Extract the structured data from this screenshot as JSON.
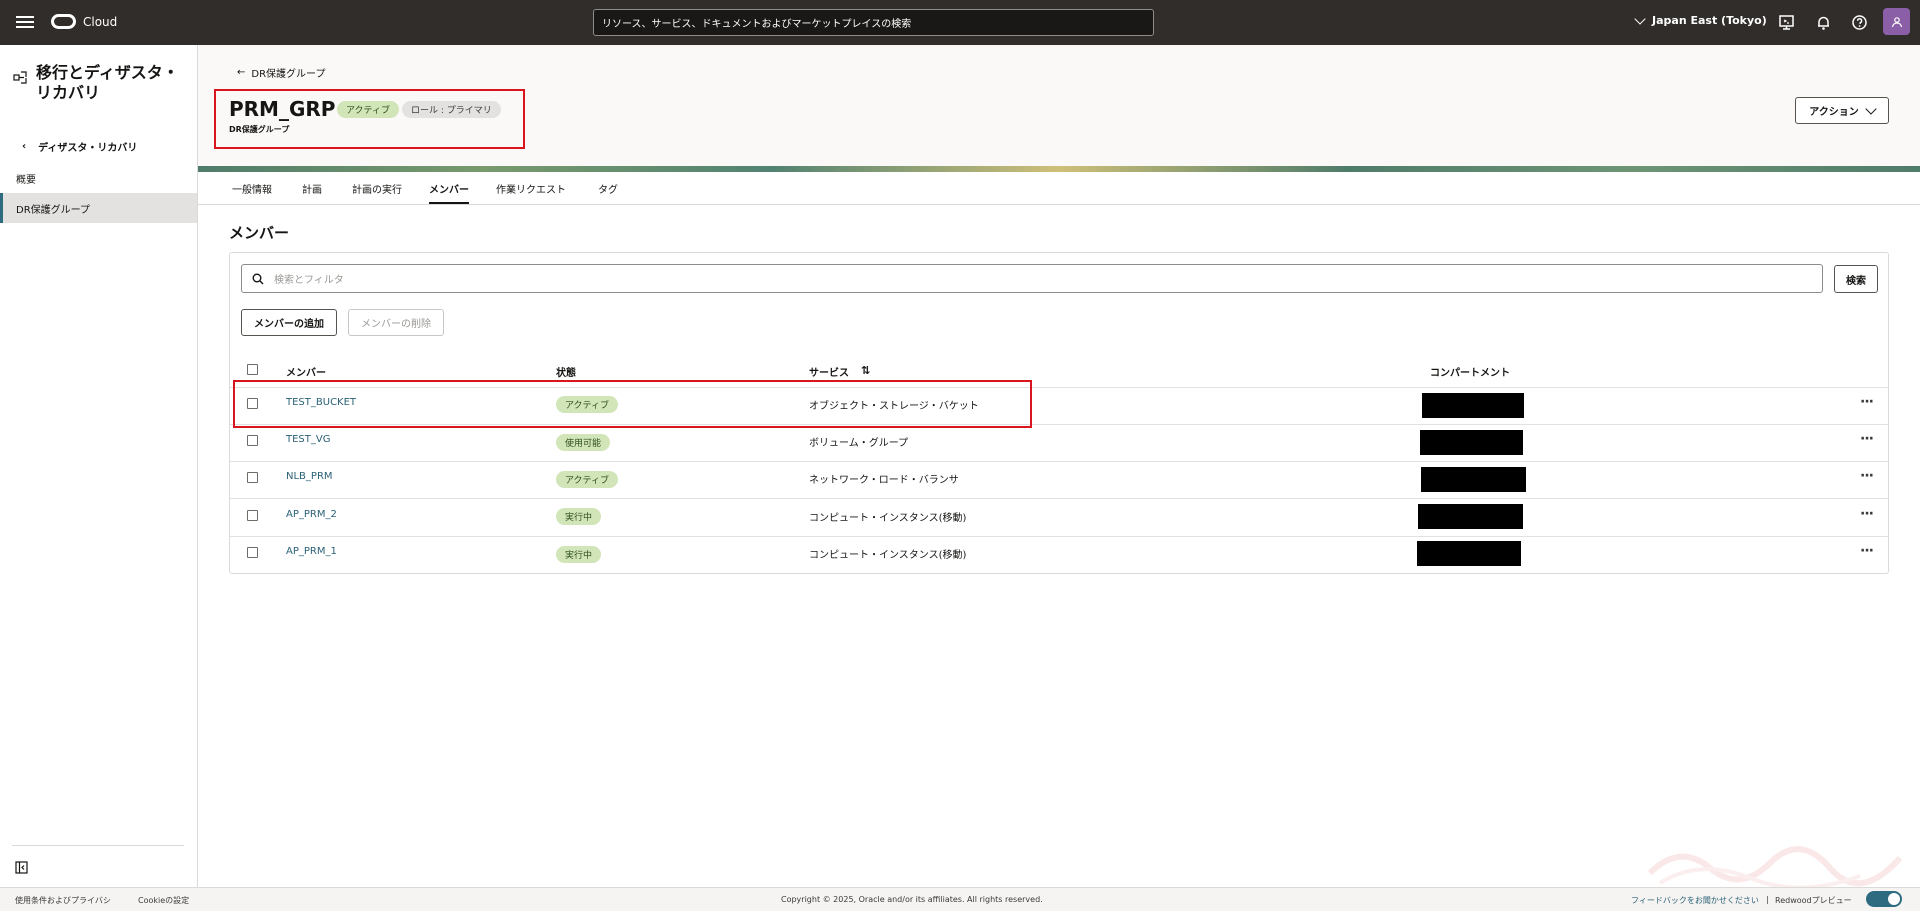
{
  "topbar": {
    "brand": "Cloud",
    "search_placeholder": "リソース、サービス、ドキュメントおよびマーケットプレイスの検索",
    "region": "Japan East (Tokyo)"
  },
  "sidebar": {
    "title": "移行とディザスタ・リカバリ",
    "back_label": "ディザスタ・リカバリ",
    "items": [
      {
        "label": "概要"
      },
      {
        "label": "DR保護グループ"
      }
    ]
  },
  "header": {
    "back_label": "DR保護グループ",
    "title": "PRM_GRP",
    "badge_status": "アクティブ",
    "badge_role": "ロール : プライマリ",
    "subtitle": "DR保護グループ",
    "action_label": "アクション"
  },
  "tabs": [
    {
      "label": "一般情報"
    },
    {
      "label": "計画"
    },
    {
      "label": "計画の実行"
    },
    {
      "label": "メンバー"
    },
    {
      "label": "作業リクエスト"
    },
    {
      "label": "タグ"
    }
  ],
  "members": {
    "section_title": "メンバー",
    "filter_placeholder": "検索とフィルタ",
    "search_button": "検索",
    "add_button": "メンバーの追加",
    "delete_button": "メンバーの削除",
    "columns": [
      "メンバー",
      "状態",
      "サービス",
      "コンパートメント"
    ],
    "rows": [
      {
        "name": "TEST_BUCKET",
        "state": "アクティブ",
        "service": "オブジェクト・ストレージ・バケット"
      },
      {
        "name": "TEST_VG",
        "state": "使用可能",
        "service": "ボリューム・グループ"
      },
      {
        "name": "NLB_PRM",
        "state": "アクティブ",
        "service": "ネットワーク・ロード・バランサ"
      },
      {
        "name": "AP_PRM_2",
        "state": "実行中",
        "service": "コンピュート・インスタンス(移動)"
      },
      {
        "name": "AP_PRM_1",
        "state": "実行中",
        "service": "コンピュート・インスタンス(移動)"
      }
    ]
  },
  "footer": {
    "terms": "使用条件およびプライバシ",
    "cookie": "Cookieの設定",
    "copyright": "Copyright © 2025, Oracle and/or its affiliates. All rights reserved.",
    "feedback": "フィードバックをお聞かせください",
    "preview": "Redwoodプレビュー"
  },
  "colors": {
    "topbar": "#312d2a",
    "link": "#2a6177",
    "highlight": "#d9161e",
    "badge_green": "#d2e5b8"
  }
}
